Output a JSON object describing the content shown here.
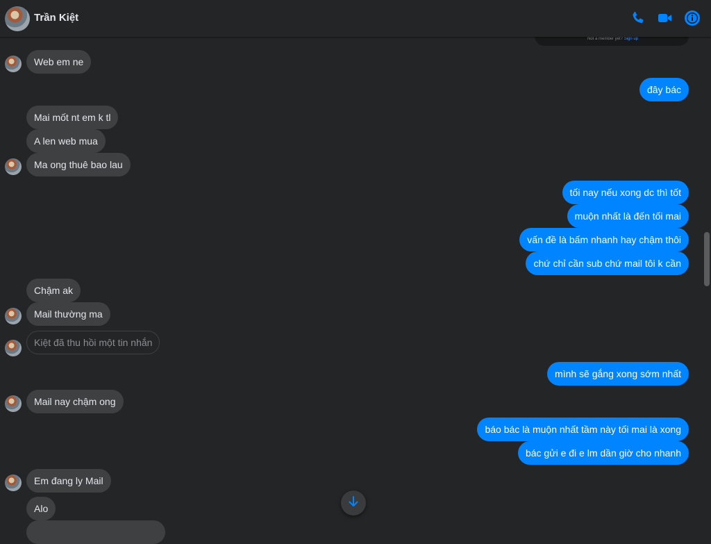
{
  "header": {
    "contact_name": "Trần Kiệt",
    "icons": [
      "phone-icon",
      "video-camera-icon",
      "info-icon"
    ],
    "accent_color": "#0084ff"
  },
  "preview_card": {
    "text": "Not a member yet?",
    "link": "Sign up"
  },
  "messages": [
    {
      "from": "contact",
      "text": "Web em ne"
    },
    {
      "from": "me",
      "text": "đây bác"
    },
    {
      "from": "contact",
      "text": "Mai mốt nt em k tl"
    },
    {
      "from": "contact",
      "text": "A len web mua"
    },
    {
      "from": "contact",
      "text": "Ma ong thuê bao lau"
    },
    {
      "from": "me",
      "text": "tối nay nếu xong dc thì tốt"
    },
    {
      "from": "me",
      "text": "muộn nhất là đến tối mai"
    },
    {
      "from": "me",
      "text": "vấn đề là bấm nhanh hay chậm thôi"
    },
    {
      "from": "me",
      "text": "chứ chỉ cần sub chứ mail tôi k cần"
    },
    {
      "from": "contact",
      "text": "Chậm ak"
    },
    {
      "from": "contact",
      "text": "Mail thường ma"
    },
    {
      "from": "contact",
      "text": "Kiệt đã thu hồi một tin nhắn",
      "recalled": true
    },
    {
      "from": "me",
      "text": "mình sẽ gắng xong sớm nhất"
    },
    {
      "from": "contact",
      "text": "Mail nay chậm ong"
    },
    {
      "from": "me",
      "text": "báo bác là muộn nhất tầm này tối mai là xong"
    },
    {
      "from": "me",
      "text": "bác gửi e đi e lm dần giờ cho nhanh"
    },
    {
      "from": "contact",
      "text": "Em đang ly Mail"
    },
    {
      "from": "contact",
      "text": "Alo"
    }
  ],
  "colors": {
    "background": "#242526",
    "incoming_bubble": "#3e4042",
    "outgoing_bubble": "#0084ff",
    "text": "#e4e6eb",
    "muted": "#8a8d91"
  }
}
